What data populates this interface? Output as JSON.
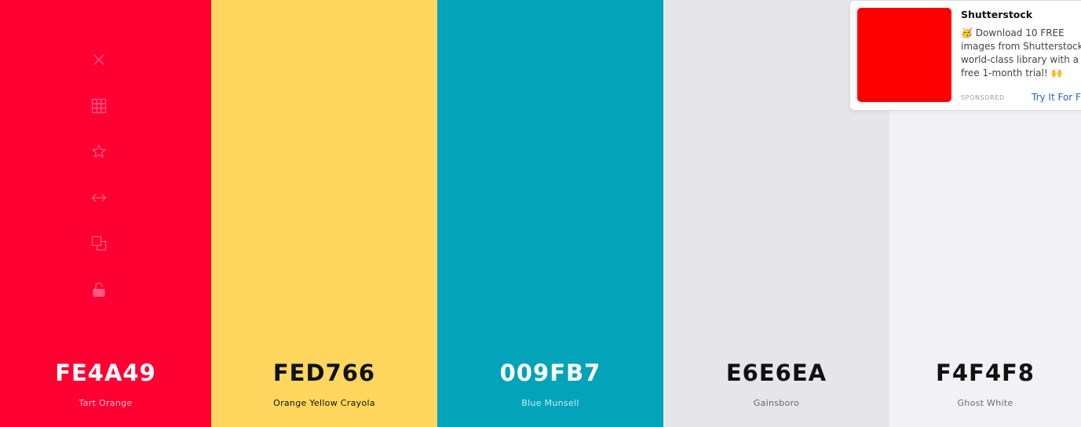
{
  "swatches": [
    {
      "hex": "FE4A49",
      "name": "Tart Orange",
      "bg": "#ff0033",
      "text_color": "#ffffff"
    },
    {
      "hex": "FED766",
      "name": "Orange Yellow Crayola",
      "bg": "#ffd75e",
      "text_color": "#111111"
    },
    {
      "hex": "009FB7",
      "name": "Blue Munsell",
      "bg": "#03a3ba",
      "text_color": "#ffffff"
    },
    {
      "hex": "E6E6EA",
      "name": "Gainsboro",
      "bg": "#e6e6ea",
      "text_color": "#111111"
    },
    {
      "hex": "F4F4F8",
      "name": "Ghost White",
      "bg": "#f2f2f6",
      "text_color": "#111111"
    }
  ],
  "toolbar": {
    "icon_color": "#ff5c85",
    "tools": [
      "close-icon",
      "grid-icon",
      "star-icon",
      "arrows-horizontal-icon",
      "copy-icon",
      "unlock-icon"
    ]
  },
  "ad": {
    "title": "Shutterstock",
    "lines": [
      "🥳 Download 10 FREE",
      "images from Shutterstock's",
      "world-class library with a",
      "free 1-month trial! 🙌"
    ],
    "sponsored_label": "SPONSORED",
    "cta_label": "Try It For Free",
    "image_color": "#ff0000"
  }
}
